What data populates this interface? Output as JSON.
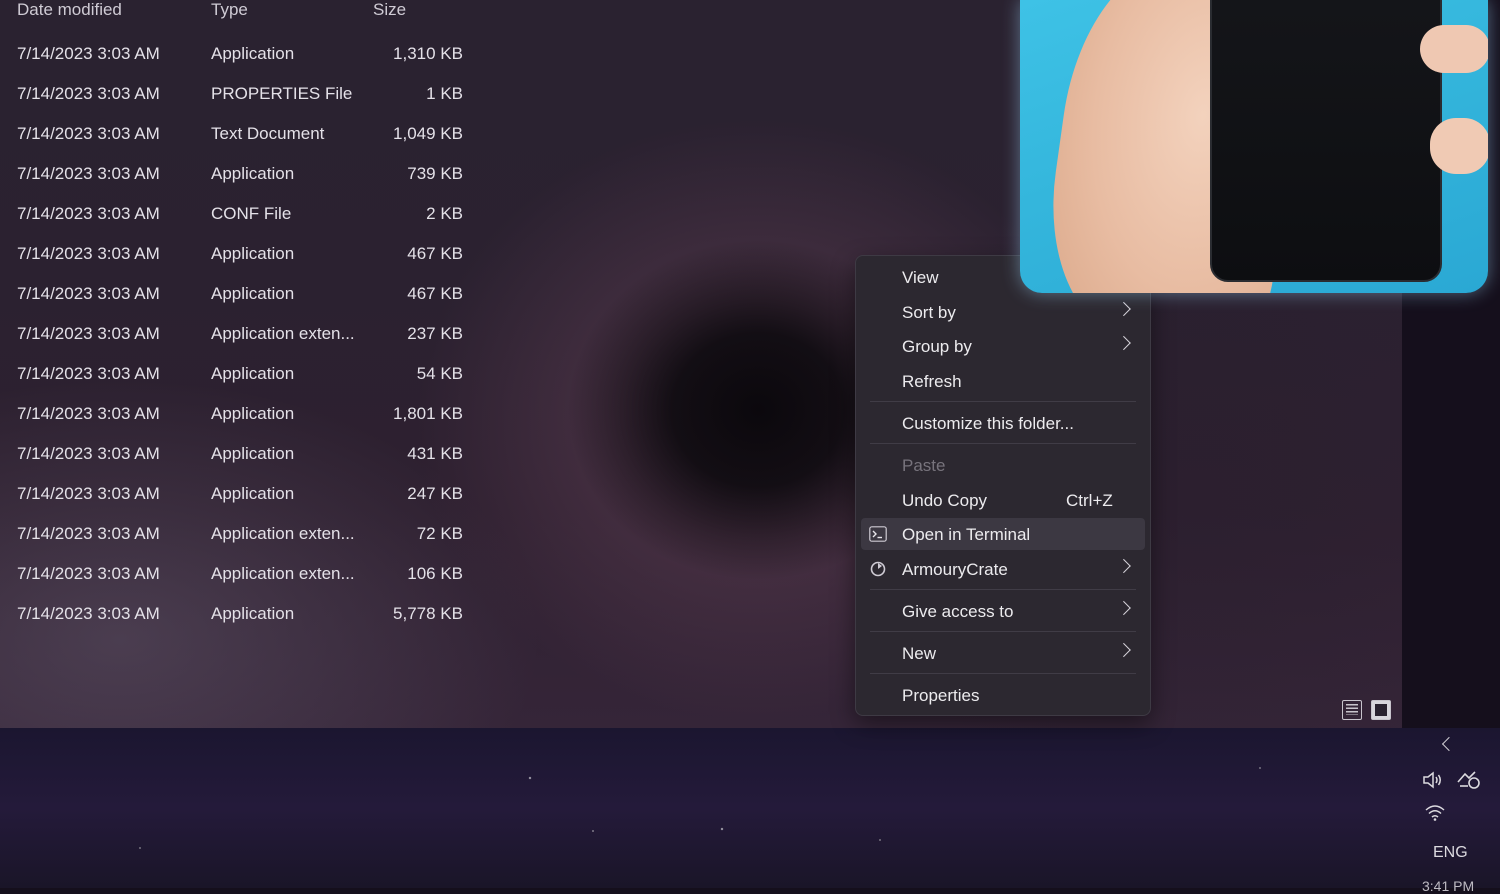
{
  "file_list": {
    "headers": {
      "date": "Date modified",
      "type": "Type",
      "size": "Size"
    },
    "rows": [
      {
        "date": "7/14/2023 3:03 AM",
        "type": "Application",
        "size": "1,310 KB"
      },
      {
        "date": "7/14/2023 3:03 AM",
        "type": "PROPERTIES File",
        "size": "1 KB"
      },
      {
        "date": "7/14/2023 3:03 AM",
        "type": "Text Document",
        "size": "1,049 KB"
      },
      {
        "date": "7/14/2023 3:03 AM",
        "type": "Application",
        "size": "739 KB"
      },
      {
        "date": "7/14/2023 3:03 AM",
        "type": "CONF File",
        "size": "2 KB"
      },
      {
        "date": "7/14/2023 3:03 AM",
        "type": "Application",
        "size": "467 KB"
      },
      {
        "date": "7/14/2023 3:03 AM",
        "type": "Application",
        "size": "467 KB"
      },
      {
        "date": "7/14/2023 3:03 AM",
        "type": "Application exten...",
        "size": "237 KB"
      },
      {
        "date": "7/14/2023 3:03 AM",
        "type": "Application",
        "size": "54 KB"
      },
      {
        "date": "7/14/2023 3:03 AM",
        "type": "Application",
        "size": "1,801 KB"
      },
      {
        "date": "7/14/2023 3:03 AM",
        "type": "Application",
        "size": "431 KB"
      },
      {
        "date": "7/14/2023 3:03 AM",
        "type": "Application",
        "size": "247 KB"
      },
      {
        "date": "7/14/2023 3:03 AM",
        "type": "Application exten...",
        "size": "72 KB"
      },
      {
        "date": "7/14/2023 3:03 AM",
        "type": "Application exten...",
        "size": "106 KB"
      },
      {
        "date": "7/14/2023 3:03 AM",
        "type": "Application",
        "size": "5,778 KB"
      }
    ]
  },
  "context_menu": {
    "view": "View",
    "sort_by": "Sort by",
    "group_by": "Group by",
    "refresh": "Refresh",
    "customize": "Customize this folder...",
    "paste": "Paste",
    "undo_copy": "Undo Copy",
    "undo_shortcut": "Ctrl+Z",
    "open_terminal": "Open in Terminal",
    "armoury_crate": "ArmouryCrate",
    "give_access": "Give access to",
    "new": "New",
    "properties": "Properties"
  },
  "tray": {
    "language": "ENG",
    "time": "3:41 PM"
  },
  "icons": [
    "chevron-right-icon",
    "terminal-icon",
    "armoury-crate-icon",
    "details-view-icon",
    "tiles-view-icon",
    "volume-icon",
    "wifi-icon",
    "touch-keyboard-icon"
  ]
}
